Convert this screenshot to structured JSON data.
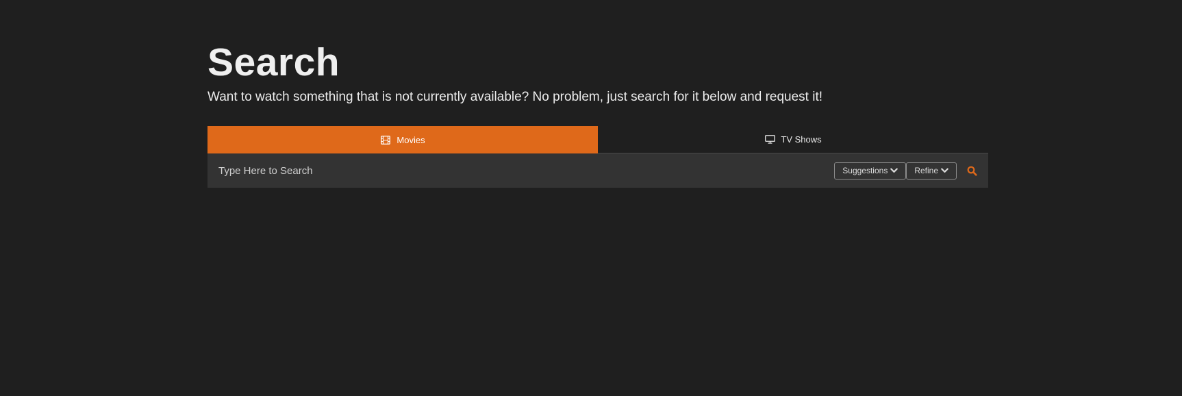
{
  "header": {
    "title": "Search",
    "subtitle": "Want to watch something that is not currently available? No problem, just search for it below and request it!"
  },
  "tabs": [
    {
      "label": "Movies",
      "icon": "film-icon",
      "active": true
    },
    {
      "label": "TV Shows",
      "icon": "tv-icon",
      "active": false
    }
  ],
  "search": {
    "placeholder": "Type Here to Search",
    "value": ""
  },
  "buttons": {
    "suggestions_label": "Suggestions",
    "refine_label": "Refine"
  },
  "colors": {
    "background": "#1f1f1f",
    "accent": "#df691a",
    "search_bar": "#333333",
    "text": "#efefef"
  }
}
